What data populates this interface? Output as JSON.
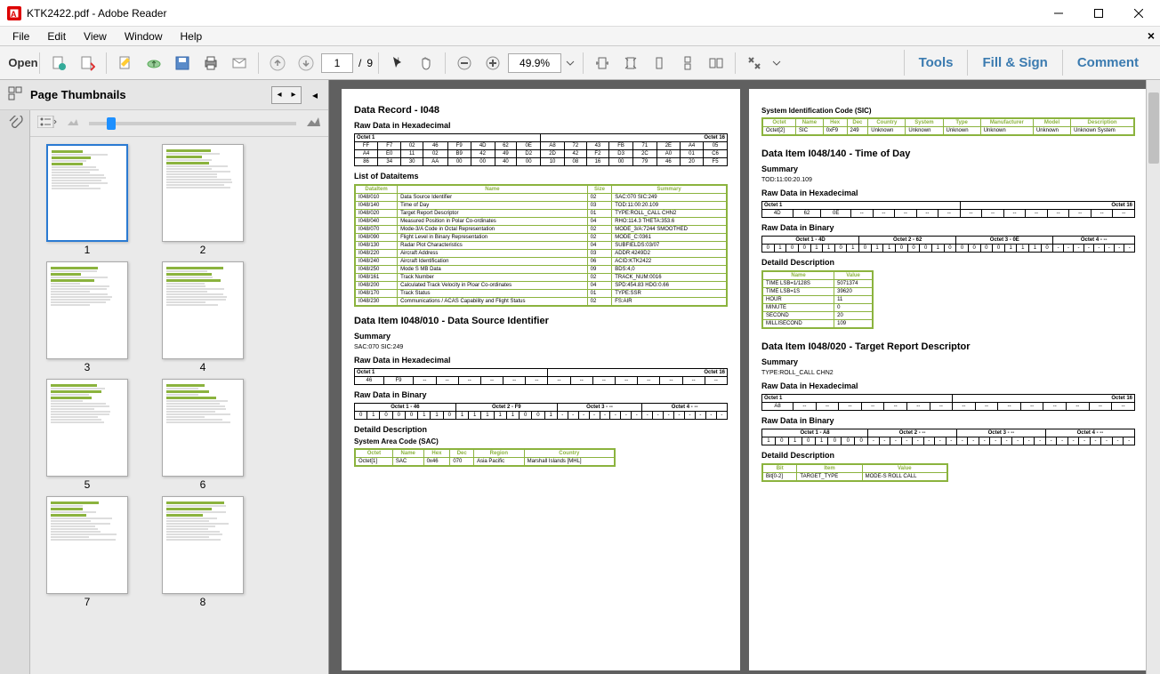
{
  "window": {
    "title": "KTK2422.pdf - Adobe Reader"
  },
  "menu": {
    "file": "File",
    "edit": "Edit",
    "view": "View",
    "window": "Window",
    "help": "Help"
  },
  "toolbar": {
    "open": "Open",
    "page_current": "1",
    "page_sep": "/",
    "page_total": "9",
    "zoom": "49.9%"
  },
  "rightlinks": {
    "tools": "Tools",
    "fillsign": "Fill & Sign",
    "comment": "Comment"
  },
  "sidebar": {
    "title": "Page Thumbnails",
    "labels": [
      "1",
      "2",
      "3",
      "4",
      "5",
      "6",
      "7",
      "8"
    ]
  },
  "doc": {
    "p1": {
      "title": "Data Record - I048",
      "raw_hex_title": "Raw Data in Hexadecimal",
      "hex_header_left": "Octet 1",
      "hex_header_right": "Octet 16",
      "hex_rows": [
        [
          "FF",
          "F7",
          "02",
          "46",
          "F9",
          "4D",
          "62",
          "0E",
          "A8",
          "72",
          "43",
          "FB",
          "71",
          "2E",
          "A4",
          "05"
        ],
        [
          "A4",
          "E0",
          "11",
          "02",
          "B9",
          "42",
          "49",
          "D2",
          "2D",
          "42",
          "F2",
          "D3",
          "2C",
          "A0",
          "01",
          "C6"
        ],
        [
          "86",
          "34",
          "30",
          "AA",
          "00",
          "00",
          "40",
          "00",
          "10",
          "08",
          "16",
          "00",
          "79",
          "46",
          "20",
          "F5"
        ]
      ],
      "list_title": "List of Dataitems",
      "list_headers": [
        "DataItem",
        "Name",
        "Size",
        "Summary"
      ],
      "list_rows": [
        [
          "I048/010",
          "Data Source Identifier",
          "02",
          "SAC:070 SIC:249"
        ],
        [
          "I048/140",
          "Time of Day",
          "03",
          "TOD:11:00:20.109"
        ],
        [
          "I048/020",
          "Target Report Descriptor",
          "01",
          "TYPE:ROLL_CALL CHN2"
        ],
        [
          "I048/040",
          "Measured Position in Polar Co-ordinates",
          "04",
          "RHO:114.3 THETA:353.6"
        ],
        [
          "I048/070",
          "Mode-3/A Code in Octal Representation",
          "02",
          "MODE_3/A:7244 SMOOTHED"
        ],
        [
          "I048/090",
          "Flight Level in Binary Representation",
          "02",
          "MODE_C:0361"
        ],
        [
          "I048/130",
          "Radar Plot Characteristics",
          "04",
          "SUBFIELDS:03/07"
        ],
        [
          "I048/220",
          "Aircraft Address",
          "03",
          "ADDR:4249D2"
        ],
        [
          "I048/240",
          "Aircraft Identification",
          "06",
          "ACID:KTK2422"
        ],
        [
          "I048/250",
          "Mode S MB Data",
          "09",
          "BDS:4,0"
        ],
        [
          "I048/161",
          "Track Number",
          "02",
          "TRACK_NUM:0016"
        ],
        [
          "I048/200",
          "Calculated Track Velocity in Ploar Co-ordinates",
          "04",
          "SPD:454.83 HDG:0.66"
        ],
        [
          "I048/170",
          "Track Status",
          "01",
          "TYPE:SSR"
        ],
        [
          "I048/230",
          "Communications / ACAS Capability and Flight Status",
          "02",
          "FS:AIR"
        ]
      ],
      "di010_title": "Data Item I048/010 - Data Source Identifier",
      "summary_label": "Summary",
      "di010_summary": "SAC:070 SIC:249",
      "di010_hex": [
        "46",
        "F9",
        "--",
        "--",
        "--",
        "--",
        "--",
        "--",
        "--",
        "--",
        "--",
        "--",
        "--",
        "--",
        "--",
        "--"
      ],
      "binary_title": "Raw Data in Binary",
      "bin_headers": [
        "Octet 1 - 46",
        "Octet 2 - F9",
        "Octet 3 - --",
        "Octet 4 - --"
      ],
      "bin_row1": [
        "0",
        "1",
        "0",
        "0",
        "0",
        "1",
        "1",
        "0",
        "1",
        "1",
        "1",
        "1",
        "1",
        "0",
        "0",
        "1",
        "-",
        "-",
        "-",
        "-",
        "-",
        "-",
        "-",
        "-",
        "-",
        "-",
        "-",
        "-",
        "-",
        "-",
        "-",
        "-"
      ],
      "detail_title": "Detaild Description",
      "sac_title": "System Area Code (SAC)",
      "sac_headers": [
        "Octet",
        "Name",
        "Hex",
        "Dec",
        "Region",
        "Country"
      ],
      "sac_row": [
        "Octet[1]",
        "SAC",
        "0x46",
        "070",
        "Asia Pacific",
        "Marshall Islands [MHL]"
      ]
    },
    "p2": {
      "sic_title": "System Identification Code (SIC)",
      "sic_headers": [
        "Octet",
        "Name",
        "Hex",
        "Dec",
        "Country",
        "System",
        "Type",
        "Manufacturer",
        "Model",
        "Description"
      ],
      "sic_row": [
        "Octet[2]",
        "SIC",
        "0xF9",
        "249",
        "Unknown",
        "Unknown",
        "Unknown",
        "Unknown",
        "Unknown",
        "Unknown System"
      ],
      "di140_title": "Data Item I048/140 - Time of Day",
      "summary_label": "Summary",
      "di140_summary": "TOD:11:00:20.109",
      "raw_hex_title": "Raw Data in Hexadecimal",
      "hex_header_left": "Octet 1",
      "hex_header_right": "Octet 16",
      "di140_hex": [
        "4D",
        "62",
        "0E",
        "--",
        "--",
        "--",
        "--",
        "--",
        "--",
        "--",
        "--",
        "--",
        "--",
        "--",
        "--",
        "--"
      ],
      "binary_title": "Raw Data in Binary",
      "bin_headers": [
        "Octet 1 - 4D",
        "Octet 2 - 62",
        "Octet 3 - 0E",
        "Octet 4 - --"
      ],
      "bin_row": [
        "0",
        "1",
        "0",
        "0",
        "1",
        "1",
        "0",
        "1",
        "0",
        "1",
        "1",
        "0",
        "0",
        "0",
        "1",
        "0",
        "0",
        "0",
        "0",
        "0",
        "1",
        "1",
        "1",
        "0",
        "-",
        "-",
        "-",
        "-",
        "-",
        "-",
        "-",
        "-"
      ],
      "detail_title": "Detaild Description",
      "time_headers": [
        "Name",
        "Value"
      ],
      "time_rows": [
        [
          "TIME LSB=1/128S",
          "5071374"
        ],
        [
          "TIME LSB=1S",
          "39620"
        ],
        [
          "HOUR",
          "11"
        ],
        [
          "MINUTE",
          "0"
        ],
        [
          "SECOND",
          "20"
        ],
        [
          "MILLISECOND",
          "109"
        ]
      ],
      "di020_title": "Data Item I048/020 - Target Report Descriptor",
      "di020_summary": "TYPE:ROLL_CALL CHN2",
      "di020_hex": [
        "A8",
        "--",
        "--",
        "--",
        "--",
        "--",
        "--",
        "--",
        "--",
        "--",
        "--",
        "--",
        "--",
        "--",
        "--",
        "--"
      ],
      "bin020_headers": [
        "Octet 1 - A8",
        "Octet 2 - --",
        "Octet 3 - --",
        "Octet 4 - --"
      ],
      "bin020_row": [
        "1",
        "0",
        "1",
        "0",
        "1",
        "0",
        "0",
        "0",
        "-",
        "-",
        "-",
        "-",
        "-",
        "-",
        "-",
        "-",
        "-",
        "-",
        "-",
        "-",
        "-",
        "-",
        "-",
        "-",
        "-",
        "-",
        "-",
        "-",
        "-",
        "-",
        "-",
        "-"
      ],
      "trd_headers": [
        "Bit",
        "Item",
        "Value"
      ],
      "trd_row": [
        "Bit[0-2]",
        "TARGET_TYPE",
        "MODE-S ROLL CALL"
      ]
    }
  }
}
